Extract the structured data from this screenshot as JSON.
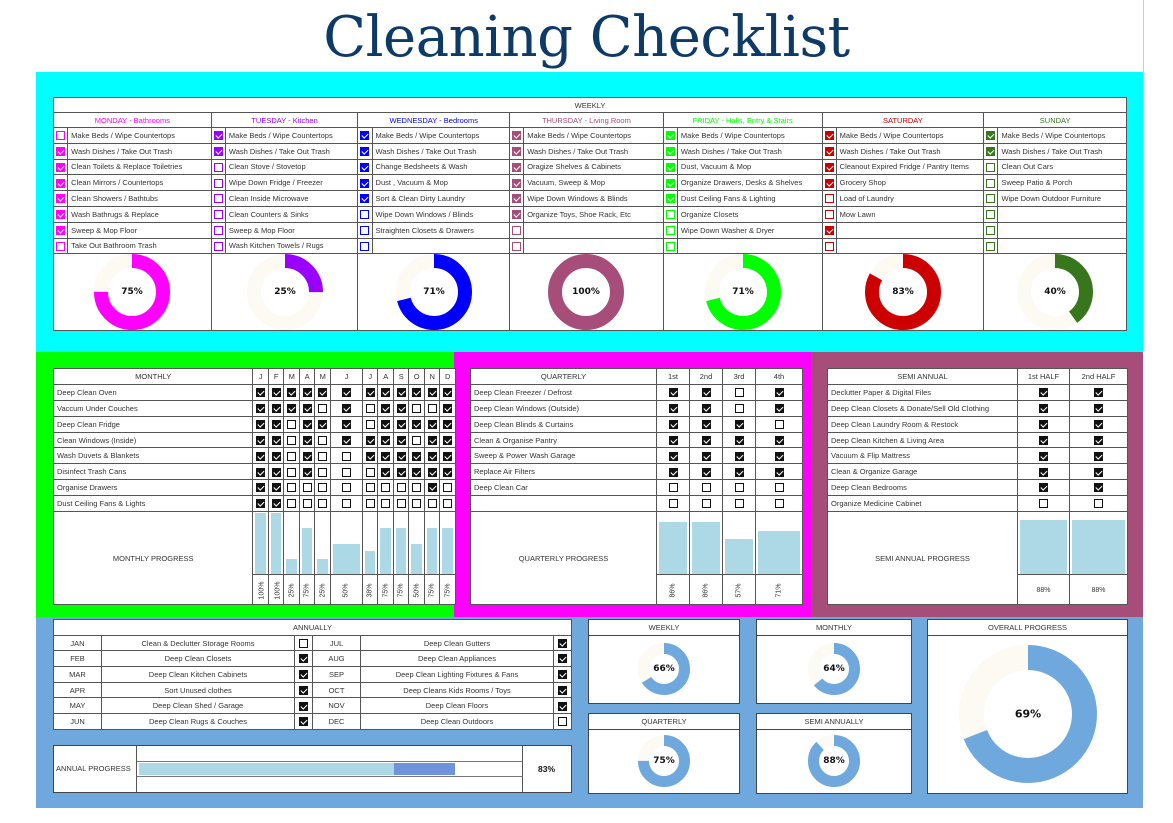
{
  "title": "Cleaning Checklist",
  "colors": {
    "weekly_band": "#00ffff",
    "monthly_band": "#00ff00",
    "quarterly_band": "#ff00ff",
    "semi_band": "#a64d79",
    "annual_band": "#6fa8dc",
    "bar": "#add8e6",
    "donut_blue": "#6fa8dc",
    "donut_track": "#fdf9f3"
  },
  "weekly": {
    "header": "WEEKLY",
    "days": [
      {
        "name": "MONDAY - Bathrooms",
        "color": "#ff00ff",
        "percent": 75,
        "tasks": [
          {
            "label": "Make Beds / Wipe Countertops",
            "done": false
          },
          {
            "label": "Wash Dishes / Take Out Trash",
            "done": true
          },
          {
            "label": "Clean Toilets & Replace Toiletries",
            "done": true
          },
          {
            "label": "Clean Mirrors / Countertops",
            "done": true
          },
          {
            "label": "Clean Showers / Bathtubs",
            "done": true
          },
          {
            "label": "Wash Bathrugs & Replace",
            "done": true
          },
          {
            "label": "Sweep & Mop Floor",
            "done": true
          },
          {
            "label": "Take Out Bathroom Trash",
            "done": false
          }
        ]
      },
      {
        "name": "TUESDAY - Kitchen",
        "color": "#9900ff",
        "percent": 25,
        "tasks": [
          {
            "label": "Make Beds / Wipe Countertops",
            "done": true
          },
          {
            "label": "Wash Dishes / Take Out Trash",
            "done": true
          },
          {
            "label": "Clean Stove / Stovetop",
            "done": false
          },
          {
            "label": "Wipe Down Fridge / Freezer",
            "done": false
          },
          {
            "label": "Clean Inside Microwave",
            "done": false
          },
          {
            "label": "Clean Counters & Sinks",
            "done": false
          },
          {
            "label": "Sweep & Mop Floor",
            "done": false
          },
          {
            "label": "Wash Kitchen Towels / Rugs",
            "done": false
          }
        ]
      },
      {
        "name": "WEDNESDAY - Bedrooms",
        "color": "#0000ff",
        "percent": 71,
        "tasks": [
          {
            "label": "Make Beds / Wipe Countertops",
            "done": true
          },
          {
            "label": "Wash Dishes / Take Out Trash",
            "done": true
          },
          {
            "label": "Change Bedsheets & Wash",
            "done": true
          },
          {
            "label": "Dust , Vacuum & Mop",
            "done": true
          },
          {
            "label": "Sort & Clean Dirty Laundry",
            "done": true
          },
          {
            "label": "Wipe Down Windows / Blinds",
            "done": false
          },
          {
            "label": "Straighten Closets & Drawers",
            "done": false
          },
          {
            "label": "",
            "done": false
          }
        ]
      },
      {
        "name": "THURSDAY - Living Room",
        "color": "#a64d79",
        "percent": 100,
        "tasks": [
          {
            "label": "Make Beds / Wipe Countertops",
            "done": true
          },
          {
            "label": "Wash Dishes / Take Out Trash",
            "done": true
          },
          {
            "label": "Oragize Shelves & Cabinets",
            "done": true
          },
          {
            "label": "Vacuum, Sweep & Mop",
            "done": true
          },
          {
            "label": "Wipe Down Windows & Blinds",
            "done": true
          },
          {
            "label": "Organize Toys, Shoe Rack, Etc",
            "done": true
          },
          {
            "label": "",
            "done": false
          },
          {
            "label": "",
            "done": false
          }
        ]
      },
      {
        "name": "FRIDAY - Halls, Entry & Stairs",
        "color": "#00ff00",
        "percent": 71,
        "tasks": [
          {
            "label": "Make Beds / Wipe Countertops",
            "done": true
          },
          {
            "label": "Wash Dishes / Take Out Trash",
            "done": true
          },
          {
            "label": "Dust, Vacuum & Mop",
            "done": true
          },
          {
            "label": "Organize Drawers, Desks & Shelves",
            "done": true
          },
          {
            "label": "Dust Ceiling Fans & Lighting",
            "done": true
          },
          {
            "label": "Organize Closets",
            "done": false
          },
          {
            "label": "Wipe Down Washer & Dryer",
            "done": false
          },
          {
            "label": "",
            "done": false
          }
        ]
      },
      {
        "name": "SATURDAY",
        "color": "#cc0000",
        "percent": 83,
        "tasks": [
          {
            "label": "Make Beds / Wipe Countertops",
            "done": true
          },
          {
            "label": "Wash Dishes / Take Out Trash",
            "done": true
          },
          {
            "label": "Cleanout Expired Fridge / Pantry Items",
            "done": true
          },
          {
            "label": "Grocery Shop",
            "done": true
          },
          {
            "label": "Load of Laundry",
            "done": false
          },
          {
            "label": "Mow Lawn",
            "done": false
          },
          {
            "label": "",
            "done": true
          },
          {
            "label": "",
            "done": false
          }
        ]
      },
      {
        "name": "SUNDAY",
        "color": "#38761d",
        "percent": 40,
        "tasks": [
          {
            "label": "Make Beds / Wipe Countertops",
            "done": true
          },
          {
            "label": "Wash Dishes / Take Out Trash",
            "done": true
          },
          {
            "label": "Clean Out Cars",
            "done": false
          },
          {
            "label": "Sweep Patio & Porch",
            "done": false
          },
          {
            "label": "Wipe Down Outdoor Furniture",
            "done": false
          },
          {
            "label": "",
            "done": false
          },
          {
            "label": "",
            "done": false
          },
          {
            "label": "",
            "done": false
          }
        ]
      }
    ]
  },
  "monthly": {
    "header": "MONTHLY",
    "months": [
      "J",
      "F",
      "M",
      "A",
      "M",
      "J",
      "J",
      "A",
      "S",
      "O",
      "N",
      "D"
    ],
    "tasks": [
      {
        "label": "Deep Clean Oven",
        "done": [
          1,
          1,
          1,
          1,
          1,
          1,
          1,
          1,
          1,
          1,
          1,
          1
        ]
      },
      {
        "label": "Vaccum Under Couches",
        "done": [
          1,
          1,
          1,
          1,
          0,
          1,
          0,
          1,
          1,
          0,
          0,
          1
        ]
      },
      {
        "label": "Deep Clean Fridge",
        "done": [
          1,
          1,
          0,
          1,
          1,
          1,
          0,
          1,
          1,
          1,
          1,
          1
        ]
      },
      {
        "label": "Clean Windows (Inside)",
        "done": [
          1,
          1,
          0,
          1,
          0,
          1,
          1,
          1,
          1,
          0,
          1,
          1
        ]
      },
      {
        "label": "Wash Duvets & Blankets",
        "done": [
          1,
          1,
          0,
          1,
          0,
          0,
          1,
          1,
          1,
          1,
          1,
          1
        ]
      },
      {
        "label": "Disinfect Trash Cans",
        "done": [
          1,
          1,
          0,
          1,
          0,
          0,
          0,
          1,
          1,
          1,
          1,
          1
        ]
      },
      {
        "label": "Organise Drawers",
        "done": [
          1,
          1,
          0,
          0,
          0,
          0,
          0,
          0,
          0,
          0,
          1,
          0
        ]
      },
      {
        "label": "Dust Ceiling Fans & Lights",
        "done": [
          1,
          1,
          0,
          0,
          0,
          0,
          0,
          0,
          0,
          0,
          0,
          0
        ]
      }
    ],
    "progress_label": "MONTHLY PROGRESS",
    "progress": [
      100,
      100,
      25,
      75,
      25,
      50,
      38,
      75,
      75,
      50,
      75,
      75
    ]
  },
  "quarterly": {
    "header": "QUARTERLY",
    "quarters": [
      "1st",
      "2nd",
      "3rd",
      "4th"
    ],
    "tasks": [
      {
        "label": "Deep Clean Freezer / Defrost",
        "done": [
          1,
          1,
          0,
          1
        ]
      },
      {
        "label": "Deep Clean Windows (Outside)",
        "done": [
          1,
          1,
          0,
          1
        ]
      },
      {
        "label": "Deep Clean Blinds & Curtains",
        "done": [
          1,
          1,
          1,
          0
        ]
      },
      {
        "label": "Clean & Organise Pantry",
        "done": [
          1,
          1,
          1,
          1
        ]
      },
      {
        "label": "Sweep & Power Wash Garage",
        "done": [
          1,
          1,
          1,
          1
        ]
      },
      {
        "label": "Replace Air Filters",
        "done": [
          1,
          1,
          1,
          1
        ]
      },
      {
        "label": "Deep Clean Car",
        "done": [
          0,
          0,
          0,
          0
        ]
      },
      {
        "label": "",
        "done": [
          0,
          0,
          0,
          0
        ]
      }
    ],
    "progress_label": "QUARTERLY PROGRESS",
    "progress": [
      86,
      86,
      57,
      71
    ]
  },
  "semi_annual": {
    "header": "SEMI ANNUAL",
    "halves": [
      "1st HALF",
      "2nd HALF"
    ],
    "tasks": [
      {
        "label": "Declutter Paper & Digital Files",
        "done": [
          1,
          1
        ]
      },
      {
        "label": "Deep Clean Closets & Donate/Sell Old Clothing",
        "done": [
          1,
          1
        ]
      },
      {
        "label": "Deep Clean Laundry Room & Restock",
        "done": [
          1,
          1
        ]
      },
      {
        "label": "Deep Clean Kitchen & Living Area",
        "done": [
          1,
          1
        ]
      },
      {
        "label": "Vacuum & Flip Mattress",
        "done": [
          1,
          1
        ]
      },
      {
        "label": "Clean & Organize Garage",
        "done": [
          1,
          1
        ]
      },
      {
        "label": "Deep Clean Bedrooms",
        "done": [
          1,
          1
        ]
      },
      {
        "label": "Organize Medicine Cabinet",
        "done": [
          0,
          0
        ]
      }
    ],
    "progress_label": "SEMI ANNUAL PROGRESS",
    "progress": [
      88,
      88
    ]
  },
  "annually": {
    "header": "ANNUALLY",
    "rows": [
      {
        "m1": "JAN",
        "t1": "Clean & Declutter Storage Rooms",
        "d1": 0,
        "m2": "JUL",
        "t2": "Deep Clean Gutters",
        "d2": 1
      },
      {
        "m1": "FEB",
        "t1": "Deep Clean Closets",
        "d1": 1,
        "m2": "AUG",
        "t2": "Deep Clean Appliances",
        "d2": 1
      },
      {
        "m1": "MAR",
        "t1": "Deep Clean Kitchen Cabinets",
        "d1": 1,
        "m2": "SEP",
        "t2": "Deep Clean Lighting Fixtures & Fans",
        "d2": 1
      },
      {
        "m1": "APR",
        "t1": "Sort Unused clothes",
        "d1": 1,
        "m2": "OCT",
        "t2": "Deep Cleans Kids Rooms / Toys",
        "d2": 1
      },
      {
        "m1": "MAY",
        "t1": "Deep Clean Shed / Garage",
        "d1": 1,
        "m2": "NOV",
        "t2": "Deep Clean Floors",
        "d2": 1
      },
      {
        "m1": "JUN",
        "t1": "Deep Clean Rugs & Couches",
        "d1": 1,
        "m2": "DEC",
        "t2": "Deep Clean Outdoors",
        "d2": 0
      }
    ],
    "progress_label": "ANNUAL PROGRESS",
    "progress": 83,
    "progress_text": "83%"
  },
  "summary": {
    "weekly": {
      "label": "WEEKLY",
      "percent": 66
    },
    "monthly": {
      "label": "MONTHLY",
      "percent": 64
    },
    "quarterly": {
      "label": "QUARTERLY",
      "percent": 75
    },
    "semi": {
      "label": "SEMI ANNUALLY",
      "percent": 88
    },
    "overall": {
      "label": "OVERALL PROGRESS",
      "percent": 69
    }
  }
}
